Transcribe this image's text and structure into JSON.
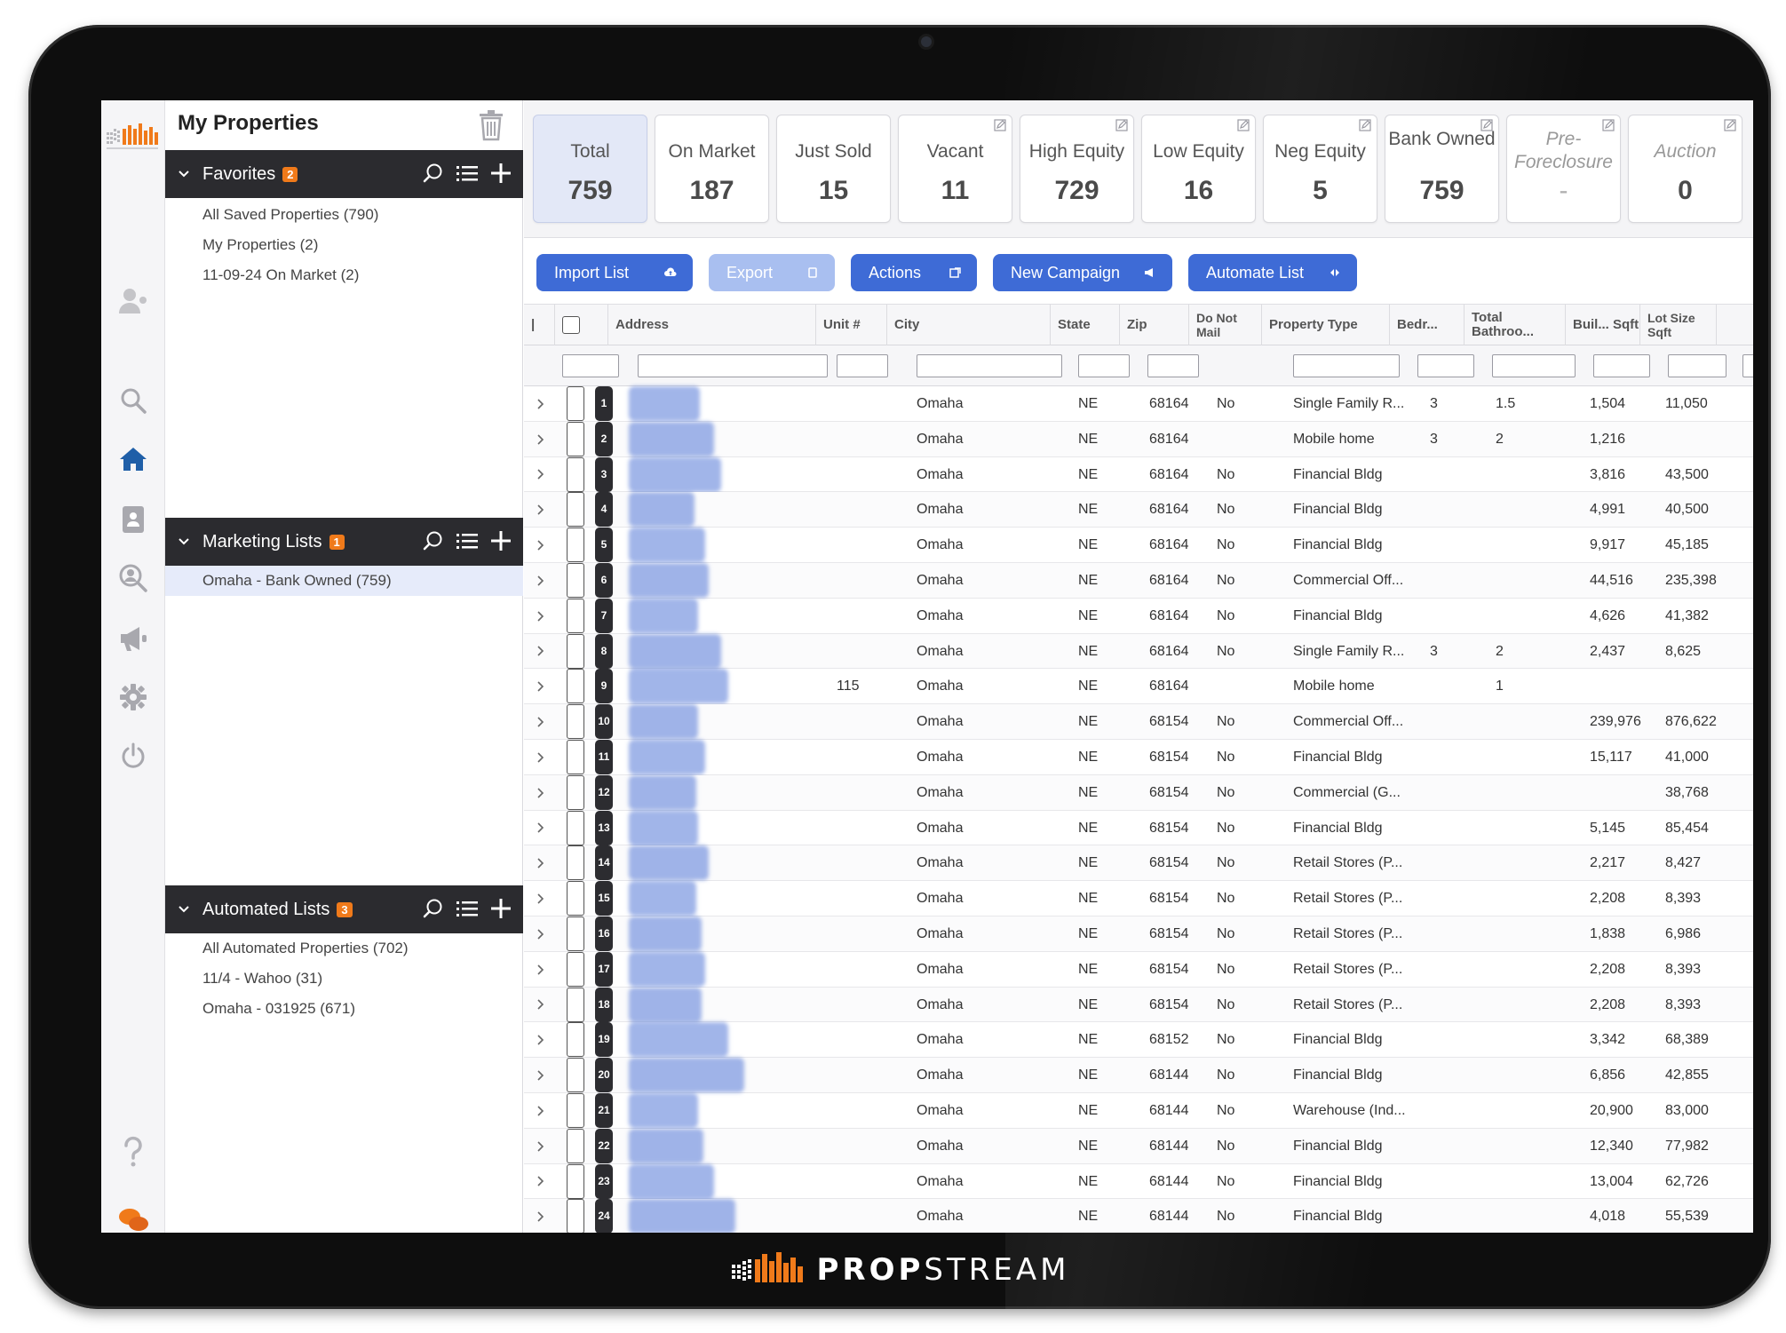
{
  "app": {
    "brand_name_bold": "PROP",
    "brand_name_light": "STREAM",
    "brand_mark": "propstream-logo-icon"
  },
  "panel": {
    "title": "My Properties",
    "sections": [
      {
        "label": "Favorites",
        "badge": "2",
        "items": [
          {
            "label": "All Saved Properties (790)",
            "selected": false
          },
          {
            "label": "My Properties (2)",
            "selected": false
          },
          {
            "label": "11-09-24 On Market (2)",
            "selected": false
          }
        ]
      },
      {
        "label": "Marketing Lists",
        "badge": "1",
        "items": [
          {
            "label": "Omaha - Bank Owned (759)",
            "selected": true
          }
        ]
      },
      {
        "label": "Automated Lists",
        "badge": "3",
        "items": [
          {
            "label": "All Automated Properties (702)",
            "selected": false
          },
          {
            "label": "11/4 - Wahoo (31)",
            "selected": false
          },
          {
            "label": "Omaha - 031925 (671)",
            "selected": false
          }
        ]
      }
    ]
  },
  "cards": [
    {
      "label": "Total",
      "value": "759",
      "active": true,
      "editable": false
    },
    {
      "label": "On Market",
      "value": "187",
      "active": false,
      "editable": false
    },
    {
      "label": "Just Sold",
      "value": "15",
      "active": false,
      "editable": false
    },
    {
      "label": "Vacant",
      "value": "11",
      "active": false,
      "editable": true
    },
    {
      "label": "High Equity",
      "value": "729",
      "active": false,
      "editable": true
    },
    {
      "label": "Low Equity",
      "value": "16",
      "active": false,
      "editable": true
    },
    {
      "label": "Neg Equity",
      "value": "5",
      "active": false,
      "editable": true
    },
    {
      "label": "Bank Owned",
      "value": "759",
      "active": false,
      "editable": true
    },
    {
      "label": "Pre-Foreclosure",
      "value": "-",
      "active": false,
      "editable": true,
      "muted": true
    },
    {
      "label": "Auction",
      "value": "0",
      "active": false,
      "editable": true,
      "muted": true
    }
  ],
  "buttons": [
    {
      "label": "Import List",
      "icon": "cloud-upload-icon",
      "disabled": false
    },
    {
      "label": "Export",
      "icon": "export-icon",
      "disabled": true
    },
    {
      "label": "Actions",
      "icon": "external-link-icon",
      "disabled": false
    },
    {
      "label": "New Campaign",
      "icon": "megaphone-icon",
      "disabled": false
    },
    {
      "label": "Automate List",
      "icon": "automate-icon",
      "disabled": false
    }
  ],
  "table": {
    "headers": {
      "address": "Address",
      "unit": "Unit #",
      "city": "City",
      "state": "State",
      "zip": "Zip",
      "do_not_mail": "Do Not Mail",
      "property_type": "Property Type",
      "bedrooms": "Bedr...",
      "bathrooms": "Total Bathroo...",
      "building_sqft": "Buil... Sqft",
      "lot_size": "Lot Size Sqft"
    },
    "rows": [
      {
        "n": "1",
        "unit": "",
        "city": "Omaha",
        "state": "NE",
        "zip": "68164",
        "dnm": "No",
        "type": "Single Family R...",
        "bed": "3",
        "bath": "1.5",
        "sqft": "1,504",
        "lot": "11,050"
      },
      {
        "n": "2",
        "unit": "",
        "city": "Omaha",
        "state": "NE",
        "zip": "68164",
        "dnm": "",
        "type": "Mobile home",
        "bed": "3",
        "bath": "2",
        "sqft": "1,216",
        "lot": ""
      },
      {
        "n": "3",
        "unit": "",
        "city": "Omaha",
        "state": "NE",
        "zip": "68164",
        "dnm": "No",
        "type": "Financial Bldg",
        "bed": "",
        "bath": "",
        "sqft": "3,816",
        "lot": "43,500"
      },
      {
        "n": "4",
        "unit": "",
        "city": "Omaha",
        "state": "NE",
        "zip": "68164",
        "dnm": "No",
        "type": "Financial Bldg",
        "bed": "",
        "bath": "",
        "sqft": "4,991",
        "lot": "40,500"
      },
      {
        "n": "5",
        "unit": "",
        "city": "Omaha",
        "state": "NE",
        "zip": "68164",
        "dnm": "No",
        "type": "Financial Bldg",
        "bed": "",
        "bath": "",
        "sqft": "9,917",
        "lot": "45,185"
      },
      {
        "n": "6",
        "unit": "",
        "city": "Omaha",
        "state": "NE",
        "zip": "68164",
        "dnm": "No",
        "type": "Commercial Off...",
        "bed": "",
        "bath": "",
        "sqft": "44,516",
        "lot": "235,398"
      },
      {
        "n": "7",
        "unit": "",
        "city": "Omaha",
        "state": "NE",
        "zip": "68164",
        "dnm": "No",
        "type": "Financial Bldg",
        "bed": "",
        "bath": "",
        "sqft": "4,626",
        "lot": "41,382"
      },
      {
        "n": "8",
        "unit": "",
        "city": "Omaha",
        "state": "NE",
        "zip": "68164",
        "dnm": "No",
        "type": "Single Family R...",
        "bed": "3",
        "bath": "2",
        "sqft": "2,437",
        "lot": "8,625"
      },
      {
        "n": "9",
        "unit": "115",
        "city": "Omaha",
        "state": "NE",
        "zip": "68164",
        "dnm": "",
        "type": "Mobile home",
        "bed": "",
        "bath": "1",
        "sqft": "",
        "lot": ""
      },
      {
        "n": "10",
        "unit": "",
        "city": "Omaha",
        "state": "NE",
        "zip": "68154",
        "dnm": "No",
        "type": "Commercial Off...",
        "bed": "",
        "bath": "",
        "sqft": "239,976",
        "lot": "876,622"
      },
      {
        "n": "11",
        "unit": "",
        "city": "Omaha",
        "state": "NE",
        "zip": "68154",
        "dnm": "No",
        "type": "Financial Bldg",
        "bed": "",
        "bath": "",
        "sqft": "15,117",
        "lot": "41,000"
      },
      {
        "n": "12",
        "unit": "",
        "city": "Omaha",
        "state": "NE",
        "zip": "68154",
        "dnm": "No",
        "type": "Commercial (G...",
        "bed": "",
        "bath": "",
        "sqft": "",
        "lot": "38,768"
      },
      {
        "n": "13",
        "unit": "",
        "city": "Omaha",
        "state": "NE",
        "zip": "68154",
        "dnm": "No",
        "type": "Financial Bldg",
        "bed": "",
        "bath": "",
        "sqft": "5,145",
        "lot": "85,454"
      },
      {
        "n": "14",
        "unit": "",
        "city": "Omaha",
        "state": "NE",
        "zip": "68154",
        "dnm": "No",
        "type": "Retail Stores (P...",
        "bed": "",
        "bath": "",
        "sqft": "2,217",
        "lot": "8,427"
      },
      {
        "n": "15",
        "unit": "",
        "city": "Omaha",
        "state": "NE",
        "zip": "68154",
        "dnm": "No",
        "type": "Retail Stores (P...",
        "bed": "",
        "bath": "",
        "sqft": "2,208",
        "lot": "8,393"
      },
      {
        "n": "16",
        "unit": "",
        "city": "Omaha",
        "state": "NE",
        "zip": "68154",
        "dnm": "No",
        "type": "Retail Stores (P...",
        "bed": "",
        "bath": "",
        "sqft": "1,838",
        "lot": "6,986"
      },
      {
        "n": "17",
        "unit": "",
        "city": "Omaha",
        "state": "NE",
        "zip": "68154",
        "dnm": "No",
        "type": "Retail Stores (P...",
        "bed": "",
        "bath": "",
        "sqft": "2,208",
        "lot": "8,393"
      },
      {
        "n": "18",
        "unit": "",
        "city": "Omaha",
        "state": "NE",
        "zip": "68154",
        "dnm": "No",
        "type": "Retail Stores (P...",
        "bed": "",
        "bath": "",
        "sqft": "2,208",
        "lot": "8,393"
      },
      {
        "n": "19",
        "unit": "",
        "city": "Omaha",
        "state": "NE",
        "zip": "68152",
        "dnm": "No",
        "type": "Financial Bldg",
        "bed": "",
        "bath": "",
        "sqft": "3,342",
        "lot": "68,389"
      },
      {
        "n": "20",
        "unit": "",
        "city": "Omaha",
        "state": "NE",
        "zip": "68144",
        "dnm": "No",
        "type": "Financial Bldg",
        "bed": "",
        "bath": "",
        "sqft": "6,856",
        "lot": "42,855"
      },
      {
        "n": "21",
        "unit": "",
        "city": "Omaha",
        "state": "NE",
        "zip": "68144",
        "dnm": "No",
        "type": "Warehouse (Ind...",
        "bed": "",
        "bath": "",
        "sqft": "20,900",
        "lot": "83,000"
      },
      {
        "n": "22",
        "unit": "",
        "city": "Omaha",
        "state": "NE",
        "zip": "68144",
        "dnm": "No",
        "type": "Financial Bldg",
        "bed": "",
        "bath": "",
        "sqft": "12,340",
        "lot": "77,982"
      },
      {
        "n": "23",
        "unit": "",
        "city": "Omaha",
        "state": "NE",
        "zip": "68144",
        "dnm": "No",
        "type": "Financial Bldg",
        "bed": "",
        "bath": "",
        "sqft": "13,004",
        "lot": "62,726"
      },
      {
        "n": "24",
        "unit": "",
        "city": "Omaha",
        "state": "NE",
        "zip": "68144",
        "dnm": "No",
        "type": "Financial Bldg",
        "bed": "",
        "bath": "",
        "sqft": "4,018",
        "lot": "55,539"
      }
    ]
  },
  "colors": {
    "accent": "#3e6bd6",
    "accent_disabled": "#a9bff0",
    "badge": "#f07a1a",
    "section_header": "#2b2b2f",
    "nav_active": "#1f5fa8",
    "bezel": "#0e0e0e"
  }
}
